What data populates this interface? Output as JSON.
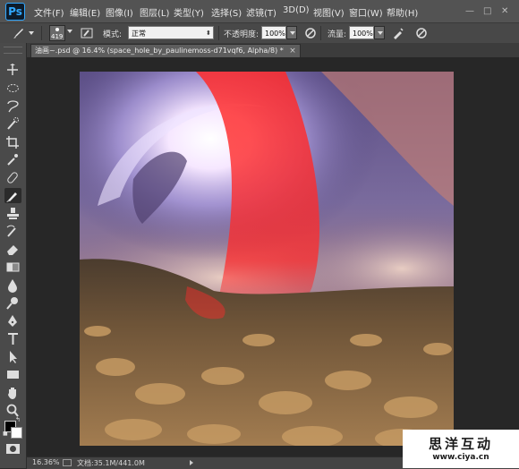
{
  "app": {
    "logo": "Ps"
  },
  "menu": [
    "文件(F)",
    "编辑(E)",
    "图像(I)",
    "图层(L)",
    "类型(Y)",
    "选择(S)",
    "滤镜(T)",
    "3D(D)",
    "视图(V)",
    "窗口(W)",
    "帮助(H)"
  ],
  "window_controls": {
    "minimize": "—",
    "maximize": "□",
    "close": "✕"
  },
  "options": {
    "brush_size": "419",
    "mode_label": "模式:",
    "mode_value": "正常",
    "opacity_label": "不透明度:",
    "opacity_value": "100%",
    "flow_label": "流量:",
    "flow_value": "100%"
  },
  "document_tab": {
    "title": "油画~.psd @ 16.4% (space_hole_by_paulinemoss-d71vqf6, Alpha/8) *",
    "close": "×"
  },
  "tools": [
    {
      "name": "move-tool"
    },
    {
      "name": "marquee-tool"
    },
    {
      "name": "lasso-tool"
    },
    {
      "name": "quick-selection-tool"
    },
    {
      "name": "crop-tool"
    },
    {
      "name": "eyedropper-tool"
    },
    {
      "name": "healing-brush-tool"
    },
    {
      "name": "brush-tool",
      "active": true
    },
    {
      "name": "clone-stamp-tool"
    },
    {
      "name": "history-brush-tool"
    },
    {
      "name": "eraser-tool"
    },
    {
      "name": "gradient-tool"
    },
    {
      "name": "blur-tool"
    },
    {
      "name": "dodge-tool"
    },
    {
      "name": "pen-tool"
    },
    {
      "name": "type-tool"
    },
    {
      "name": "path-selection-tool"
    },
    {
      "name": "rectangle-tool"
    },
    {
      "name": "hand-tool"
    },
    {
      "name": "zoom-tool"
    }
  ],
  "colors": {
    "foreground": "#000000",
    "background": "#ffffff",
    "accent": "#31a8ff",
    "overlay_red": "#ff2a2a"
  },
  "status": {
    "zoom": "16.36%",
    "doc_size": "文档:35.1M/441.0M"
  },
  "watermark": {
    "title": "思洋互动",
    "url": "www.ciya.cn"
  }
}
